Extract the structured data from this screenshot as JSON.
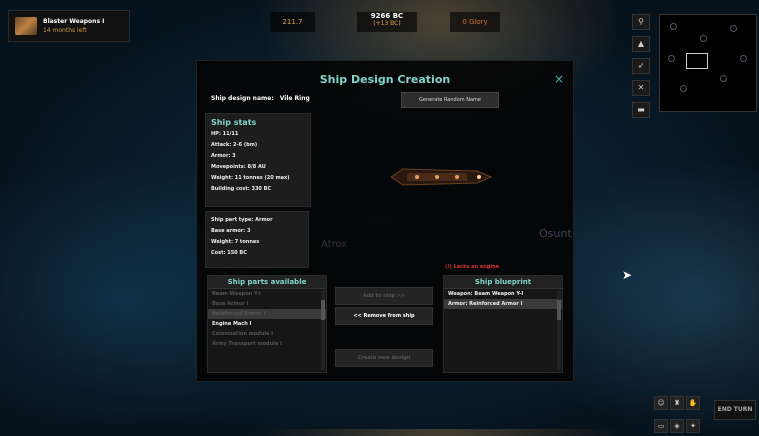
{
  "topbar": {
    "research_title": "Blaster Weapons I",
    "research_eta": "14 months left",
    "production": "211.7",
    "bc": "9266 BC",
    "bc_delta": "(+13 BC)",
    "glory": "0 Glory"
  },
  "dialog": {
    "title": "Ship Design Creation",
    "close_icon": "×",
    "name_label": "Ship design name:",
    "name_value": "Vile Ring",
    "generate_button": "Generate Random Name",
    "stats_header": "Ship stats",
    "stats": [
      "HP: 11/11",
      "Attack: 2-6 (bm)",
      "Armor: 3",
      "Movepoints: 8/8 AU",
      "Weight: 11 tonnes (20 max)",
      "Building cost: 330 BC"
    ],
    "part_info": [
      "Ship part type: Armor",
      "Base armor: 3",
      "Weight: 7 tonnes",
      "Cost: 150 BC"
    ],
    "map_label_atrox": "Atrox",
    "map_label_osunt": "Osunt",
    "warning": "(!) Lacks an engine",
    "parts_header": "Ship parts available",
    "parts": [
      "Beam Weapon Y-I",
      "Base Armor I",
      "Reinforced Armor I",
      "Engine Mach I",
      "Colonization module I",
      "Army Transport module I"
    ],
    "add_button": "Add to ship >>",
    "remove_button": "<< Remove from ship",
    "create_button": "Create new design",
    "blueprint_header": "Ship blueprint",
    "blueprint": [
      "Weapon: Beam Weapon Y-I",
      "Armor: Reinforced Armor I"
    ]
  },
  "end_turn": "END TURN",
  "colors": {
    "accent": "#7fd7c8",
    "warning": "#e03030",
    "resource": "#e8a040"
  }
}
